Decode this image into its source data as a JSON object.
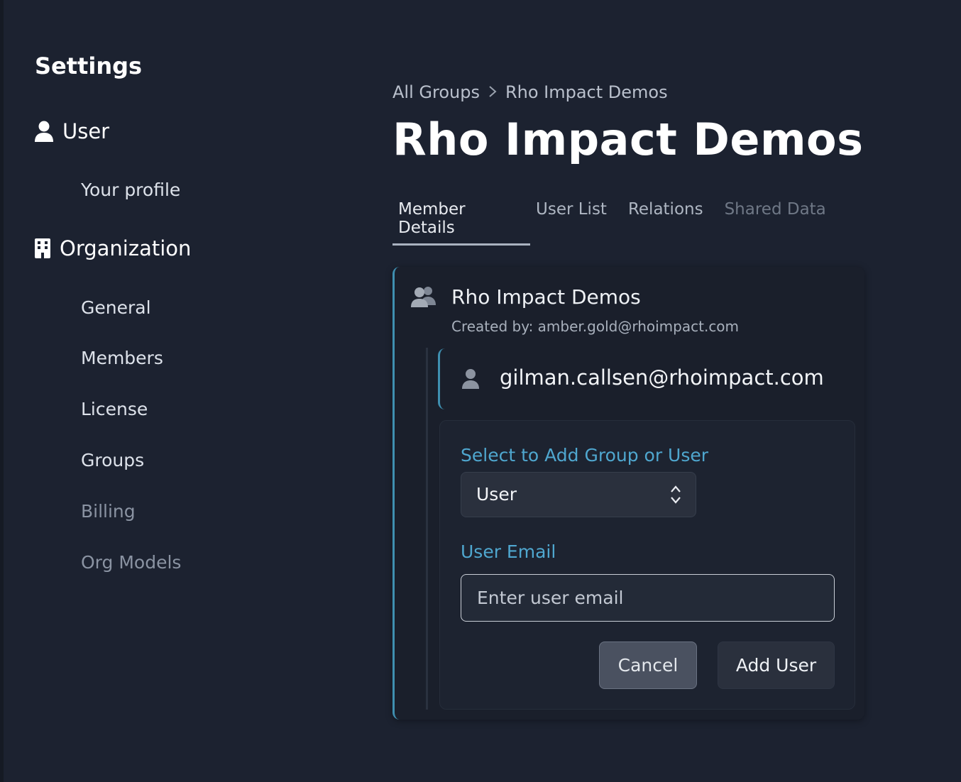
{
  "sidebar": {
    "title": "Settings",
    "sections": [
      {
        "label": "User",
        "icon": "user-icon",
        "items": [
          "Your profile"
        ]
      },
      {
        "label": "Organization",
        "icon": "building-icon",
        "items": [
          "General",
          "Members",
          "License",
          "Groups",
          "Billing",
          "Org Models"
        ]
      }
    ]
  },
  "breadcrumb": {
    "parent": "All Groups",
    "separator": ">",
    "current": "Rho Impact Demos"
  },
  "page": {
    "title": "Rho Impact Demos"
  },
  "tabs": [
    {
      "label": "Member Details",
      "state": "active"
    },
    {
      "label": "User List",
      "state": "normal"
    },
    {
      "label": "Relations",
      "state": "normal"
    },
    {
      "label": "Shared Data",
      "state": "disabled"
    }
  ],
  "group": {
    "name": "Rho Impact Demos",
    "created_by": "Created by: amber.gold@rhoimpact.com",
    "icon": "users-icon",
    "members": [
      {
        "email": "gilman.callsen@rhoimpact.com",
        "icon": "user-icon"
      }
    ]
  },
  "add_form": {
    "type_label": "Select to Add Group or User",
    "type_value": "User",
    "type_options": [
      "User"
    ],
    "email_label": "User Email",
    "email_value": "",
    "email_placeholder": "Enter user email",
    "cancel_label": "Cancel",
    "add_label": "Add User"
  },
  "colors": {
    "background": "#1c2230",
    "accent": "#4fa7cf",
    "card_border": "#3f8fb0"
  }
}
